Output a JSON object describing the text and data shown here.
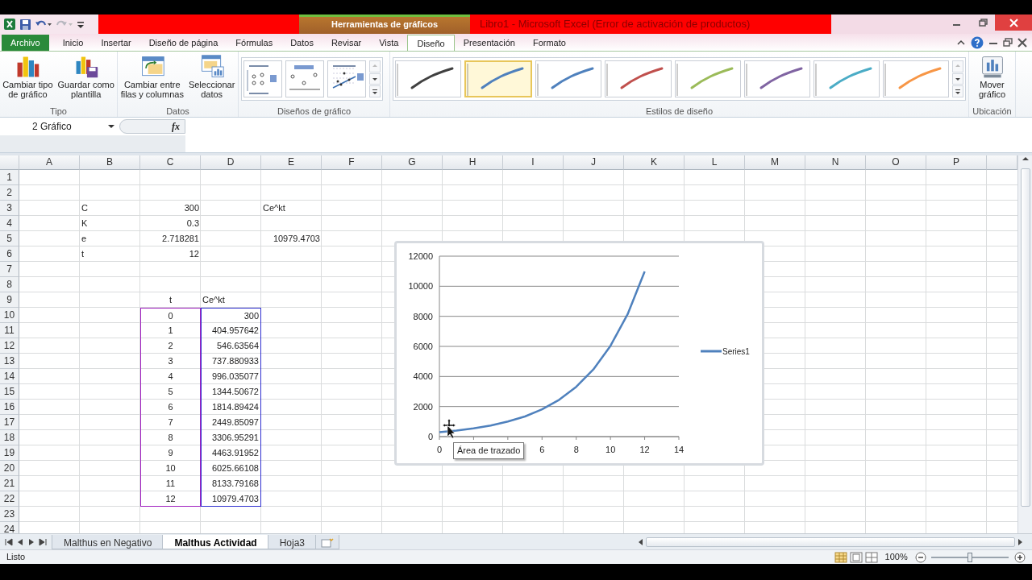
{
  "window": {
    "title": "Libro1 - Microsoft Excel (Error de activación de productos)",
    "contextual_header": "Herramientas de gráficos"
  },
  "ribbon_tabs": [
    {
      "label": "Archivo",
      "kind": "file",
      "selected": false
    },
    {
      "label": "Inicio",
      "kind": "tab",
      "selected": false
    },
    {
      "label": "Insertar",
      "kind": "tab",
      "selected": false
    },
    {
      "label": "Diseño de página",
      "kind": "tab",
      "selected": false
    },
    {
      "label": "Fórmulas",
      "kind": "tab",
      "selected": false
    },
    {
      "label": "Datos",
      "kind": "tab",
      "selected": false
    },
    {
      "label": "Revisar",
      "kind": "tab",
      "selected": false
    },
    {
      "label": "Vista",
      "kind": "tab",
      "selected": false
    },
    {
      "label": "Diseño",
      "kind": "contextual",
      "selected": true
    },
    {
      "label": "Presentación",
      "kind": "contextual",
      "selected": false
    },
    {
      "label": "Formato",
      "kind": "contextual",
      "selected": false
    }
  ],
  "ribbon_groups": [
    {
      "label": "Tipo",
      "kind": "buttons",
      "buttons": [
        {
          "label": "Cambiar tipo\nde gráfico",
          "kind": "change-type"
        },
        {
          "label": "Guardar como\nplantilla",
          "kind": "save-template"
        }
      ]
    },
    {
      "label": "Datos",
      "kind": "buttons",
      "buttons": [
        {
          "label": "Cambiar entre\nfilas y columnas",
          "kind": "switch"
        },
        {
          "label": "Seleccionar\ndatos",
          "kind": "select-data"
        }
      ]
    },
    {
      "label": "Diseños de gráfico",
      "kind": "layouts",
      "layouts": [
        {
          "kind": "legend"
        },
        {
          "kind": "markers"
        },
        {
          "kind": "scatter"
        }
      ]
    },
    {
      "label": "Estilos de diseño",
      "kind": "styles",
      "styles": [
        {
          "color": "#404040",
          "selected": false
        },
        {
          "color": "#4f81bd",
          "selected": true
        },
        {
          "color": "#4f81bd",
          "selected": false
        },
        {
          "color": "#c0504d",
          "selected": false
        },
        {
          "color": "#9bbb59",
          "selected": false
        },
        {
          "color": "#8064a2",
          "selected": false
        },
        {
          "color": "#4bacc6",
          "selected": false
        },
        {
          "color": "#f79646",
          "selected": false
        }
      ]
    },
    {
      "label": "Ubicación",
      "kind": "buttons",
      "buttons": [
        {
          "label": "Mover\ngráfico",
          "kind": "move"
        }
      ]
    }
  ],
  "formula_bar": {
    "name_box": "2 Gráfico",
    "fx": "fx"
  },
  "columns": [
    {
      "label": "A"
    },
    {
      "label": "B"
    },
    {
      "label": "C"
    },
    {
      "label": "D"
    },
    {
      "label": "E"
    },
    {
      "label": "F"
    },
    {
      "label": "G"
    },
    {
      "label": "H"
    },
    {
      "label": "I"
    },
    {
      "label": "J"
    },
    {
      "label": "K"
    },
    {
      "label": "L"
    },
    {
      "label": "M"
    },
    {
      "label": "N"
    },
    {
      "label": "O"
    },
    {
      "label": "P"
    }
  ],
  "rows": [
    {
      "label": "1"
    },
    {
      "label": "2"
    },
    {
      "label": "3",
      "cells": {
        "B": {
          "text": "C"
        },
        "C": {
          "text": "300",
          "numeric": true
        },
        "E": {
          "text": "Ce^kt"
        }
      }
    },
    {
      "label": "4",
      "cells": {
        "B": {
          "text": "K"
        },
        "C": {
          "text": "0.3",
          "numeric": true
        }
      }
    },
    {
      "label": "5",
      "cells": {
        "B": {
          "text": "e"
        },
        "C": {
          "text": "2.718281",
          "numeric": true
        },
        "E": {
          "text": "10979.4703",
          "numeric": true
        }
      }
    },
    {
      "label": "6",
      "cells": {
        "B": {
          "text": "t"
        },
        "C": {
          "text": "12",
          "numeric": true
        }
      }
    },
    {
      "label": "7"
    },
    {
      "label": "8"
    },
    {
      "label": "9",
      "cells": {
        "C": {
          "text": "t",
          "centered": true
        },
        "D": {
          "text": "Ce^kt"
        }
      }
    },
    {
      "label": "10",
      "cells": {
        "C": {
          "text": "0",
          "centered": true,
          "color": "#a020c0"
        },
        "D": {
          "text": "300",
          "numeric": true,
          "color": "#3030d0"
        }
      }
    },
    {
      "label": "11",
      "cells": {
        "C": {
          "text": "1",
          "centered": true,
          "color": "#a020c0"
        },
        "D": {
          "text": "404.957642",
          "numeric": true,
          "color": "#3030d0"
        }
      }
    },
    {
      "label": "12",
      "cells": {
        "C": {
          "text": "2",
          "centered": true,
          "color": "#a020c0"
        },
        "D": {
          "text": "546.63564",
          "numeric": true,
          "color": "#3030d0"
        }
      }
    },
    {
      "label": "13",
      "cells": {
        "C": {
          "text": "3",
          "centered": true,
          "color": "#a020c0"
        },
        "D": {
          "text": "737.880933",
          "numeric": true,
          "color": "#3030d0"
        }
      }
    },
    {
      "label": "14",
      "cells": {
        "C": {
          "text": "4",
          "centered": true,
          "color": "#a020c0"
        },
        "D": {
          "text": "996.035077",
          "numeric": true,
          "color": "#3030d0"
        }
      }
    },
    {
      "label": "15",
      "cells": {
        "C": {
          "text": "5",
          "centered": true,
          "color": "#a020c0"
        },
        "D": {
          "text": "1344.50672",
          "numeric": true,
          "color": "#3030d0"
        }
      }
    },
    {
      "label": "16",
      "cells": {
        "C": {
          "text": "6",
          "centered": true,
          "color": "#a020c0"
        },
        "D": {
          "text": "1814.89424",
          "numeric": true,
          "color": "#3030d0"
        }
      }
    },
    {
      "label": "17",
      "cells": {
        "C": {
          "text": "7",
          "centered": true,
          "color": "#a020c0"
        },
        "D": {
          "text": "2449.85097",
          "numeric": true,
          "color": "#3030d0"
        }
      }
    },
    {
      "label": "18",
      "cells": {
        "C": {
          "text": "8",
          "centered": true,
          "color": "#a020c0"
        },
        "D": {
          "text": "3306.95291",
          "numeric": true,
          "color": "#3030d0"
        }
      }
    },
    {
      "label": "19",
      "cells": {
        "C": {
          "text": "9",
          "centered": true,
          "color": "#a020c0"
        },
        "D": {
          "text": "4463.91952",
          "numeric": true,
          "color": "#3030d0"
        }
      }
    },
    {
      "label": "20",
      "cells": {
        "C": {
          "text": "10",
          "centered": true,
          "color": "#a020c0"
        },
        "D": {
          "text": "6025.66108",
          "numeric": true,
          "color": "#3030d0"
        }
      }
    },
    {
      "label": "21",
      "cells": {
        "C": {
          "text": "11",
          "centered": true,
          "color": "#a020c0"
        },
        "D": {
          "text": "8133.79168",
          "numeric": true,
          "color": "#3030d0"
        }
      }
    },
    {
      "label": "22",
      "cells": {
        "C": {
          "text": "12",
          "centered": true,
          "color": "#a020c0"
        },
        "D": {
          "text": "10979.4703",
          "numeric": true,
          "color": "#3030d0"
        }
      }
    },
    {
      "label": "23"
    },
    {
      "label": "24"
    }
  ],
  "chart": {
    "tooltip": "Área de trazado",
    "chart_data": {
      "type": "line",
      "x": [
        0,
        1,
        2,
        3,
        4,
        5,
        6,
        7,
        8,
        9,
        10,
        11,
        12
      ],
      "series": [
        {
          "name": "Series1",
          "color": "#4f81bd",
          "values": [
            300,
            400,
            550,
            740,
            1000,
            1340,
            1810,
            2450,
            3310,
            4460,
            6030,
            8130,
            10980
          ]
        }
      ],
      "xlim": [
        0,
        14
      ],
      "ylim": [
        0,
        12000
      ],
      "grid": true,
      "xticks": [
        {
          "value": 0,
          "label": "0"
        },
        {
          "value": 6,
          "label": "6"
        },
        {
          "value": 8,
          "label": "8"
        },
        {
          "value": 10,
          "label": "10"
        },
        {
          "value": 12,
          "label": "12"
        },
        {
          "value": 14,
          "label": "14"
        }
      ],
      "yticks": [
        {
          "value": 0,
          "label": "0"
        },
        {
          "value": 2000,
          "label": "2000"
        },
        {
          "value": 4000,
          "label": "4000"
        },
        {
          "value": 6000,
          "label": "6000"
        },
        {
          "value": 8000,
          "label": "8000"
        },
        {
          "value": 10000,
          "label": "10000"
        },
        {
          "value": 12000,
          "label": "12000"
        }
      ]
    }
  },
  "sheet_tabs": [
    {
      "label": "Malthus en Negativo",
      "selected": false
    },
    {
      "label": "Malthus Actividad",
      "selected": true
    },
    {
      "label": "Hoja3",
      "selected": false
    }
  ],
  "status_bar": {
    "text": "Listo",
    "zoom": "100%",
    "zoom_slider": {
      "level": 0.5
    }
  }
}
